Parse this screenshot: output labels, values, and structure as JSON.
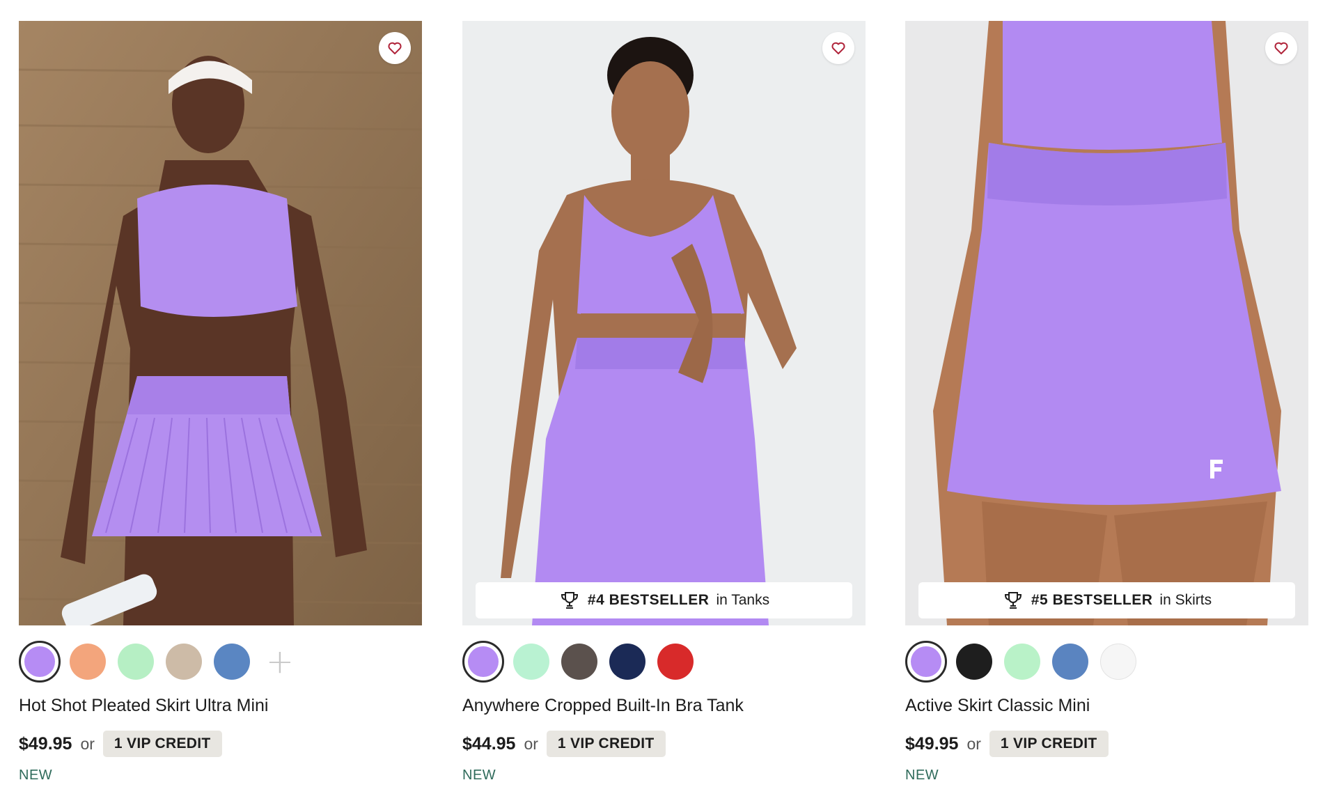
{
  "products": [
    {
      "name": "Hot Shot Pleated Skirt Ultra Mini",
      "price": "$49.95",
      "or_text": "or",
      "vip_label": "1 VIP CREDIT",
      "tag": "NEW",
      "favorite_icon": "heart-icon",
      "more_colors_label": "+",
      "swatches": [
        {
          "color": "#b68cf4",
          "selected": true
        },
        {
          "color": "#f3a57c",
          "selected": false
        },
        {
          "color": "#b6efc4",
          "selected": false
        },
        {
          "color": "#cdbba7",
          "selected": false
        },
        {
          "color": "#5a86c2",
          "selected": false
        }
      ]
    },
    {
      "name": "Anywhere Cropped Built-In Bra Tank",
      "price": "$44.95",
      "or_text": "or",
      "vip_label": "1 VIP CREDIT",
      "tag": "NEW",
      "favorite_icon": "heart-icon",
      "badge": {
        "icon": "trophy-icon",
        "rank": "#4 BESTSELLER",
        "suffix": "in Tanks"
      },
      "swatches": [
        {
          "color": "#b68cf4",
          "selected": true
        },
        {
          "color": "#b9f2d2",
          "selected": false
        },
        {
          "color": "#5b514d",
          "selected": false
        },
        {
          "color": "#1b2a56",
          "selected": false
        },
        {
          "color": "#d82a2a",
          "selected": false
        }
      ]
    },
    {
      "name": "Active Skirt Classic Mini",
      "price": "$49.95",
      "or_text": "or",
      "vip_label": "1 VIP CREDIT",
      "tag": "NEW",
      "favorite_icon": "heart-icon",
      "badge": {
        "icon": "trophy-icon",
        "rank": "#5 BESTSELLER",
        "suffix": "in Skirts"
      },
      "swatches": [
        {
          "color": "#b68cf4",
          "selected": true
        },
        {
          "color": "#1e1e1e",
          "selected": false
        },
        {
          "color": "#b9f2c8",
          "selected": false
        },
        {
          "color": "#5a84c0",
          "selected": false
        },
        {
          "color": "#f6f6f6",
          "selected": false
        }
      ]
    }
  ],
  "colors": {
    "accent_purple": "#a982f0",
    "new_tag": "#2f6b5b",
    "vip_bg": "#e8e6e1",
    "heart": "#b0243a"
  }
}
